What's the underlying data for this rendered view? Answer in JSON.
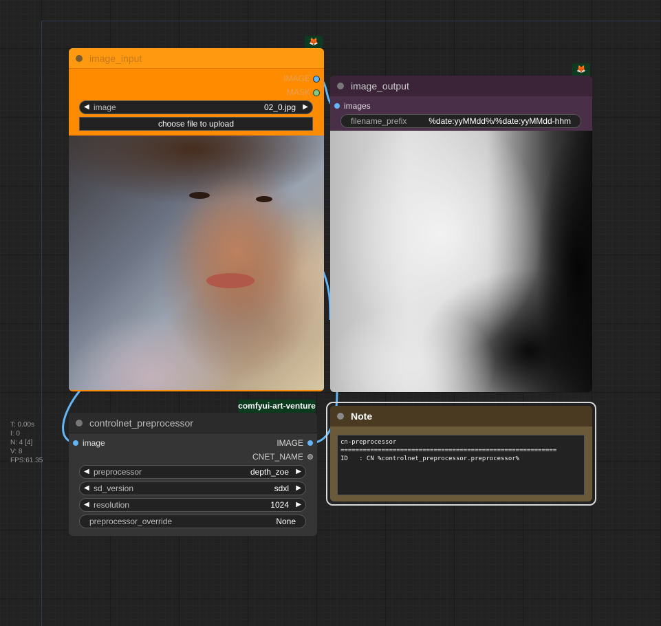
{
  "canvas_stats": {
    "t": "T: 0.00s",
    "i": "I: 0",
    "n": "N: 4 [4]",
    "v": "V: 8",
    "fps": "FPS:61.35"
  },
  "nodes": {
    "image_input": {
      "title": "image_input",
      "outputs": [
        "IMAGE",
        "MASK"
      ],
      "image_widget_label": "image",
      "image_widget_value": "02_0.jpg",
      "upload_button": "choose file to upload",
      "color": "#ff8c00"
    },
    "image_output": {
      "title": "image_output",
      "input": "images",
      "filename_prefix_label": "filename_prefix",
      "filename_prefix_value": "%date:yyMMdd%/%date:yyMMdd-hhm",
      "color": "#3b2438"
    },
    "controlnet_preprocessor": {
      "badge": "comfyui-art-venture",
      "title": "controlnet_preprocessor",
      "input": "image",
      "outputs": [
        "IMAGE",
        "CNET_NAME"
      ],
      "widgets": [
        {
          "label": "preprocessor",
          "value": "depth_zoe"
        },
        {
          "label": "sd_version",
          "value": "sdxl"
        },
        {
          "label": "resolution",
          "value": "1024"
        },
        {
          "label": "preprocessor_override",
          "value": "None"
        }
      ]
    },
    "note": {
      "title": "Note",
      "lines": [
        "cn-preprocessor",
        "==========================================================",
        "ID   : CN %controlnet_preprocessor.preprocessor%"
      ],
      "color": "#4a3a22"
    }
  },
  "icons": [
    "fox-icon",
    "arrow-left-icon",
    "arrow-right-icon"
  ]
}
